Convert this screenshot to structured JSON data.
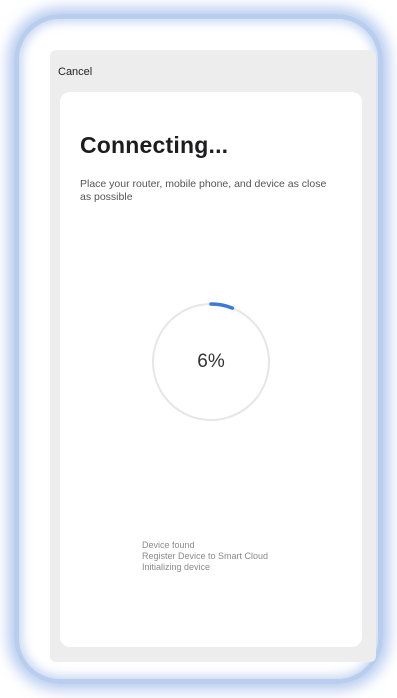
{
  "header": {
    "cancel_label": "Cancel"
  },
  "main": {
    "title": "Connecting...",
    "subtitle": "Place your router, mobile phone, and device as close as possible",
    "progress": {
      "percent_label": "6%",
      "value_percent": 6
    },
    "steps": [
      "Device found",
      "Register Device to Smart Cloud",
      "Initializing device"
    ]
  },
  "colors": {
    "accent": "#3a7bd5",
    "ring_track": "#e6e6e6",
    "frame_glow": "#b9cdef"
  }
}
